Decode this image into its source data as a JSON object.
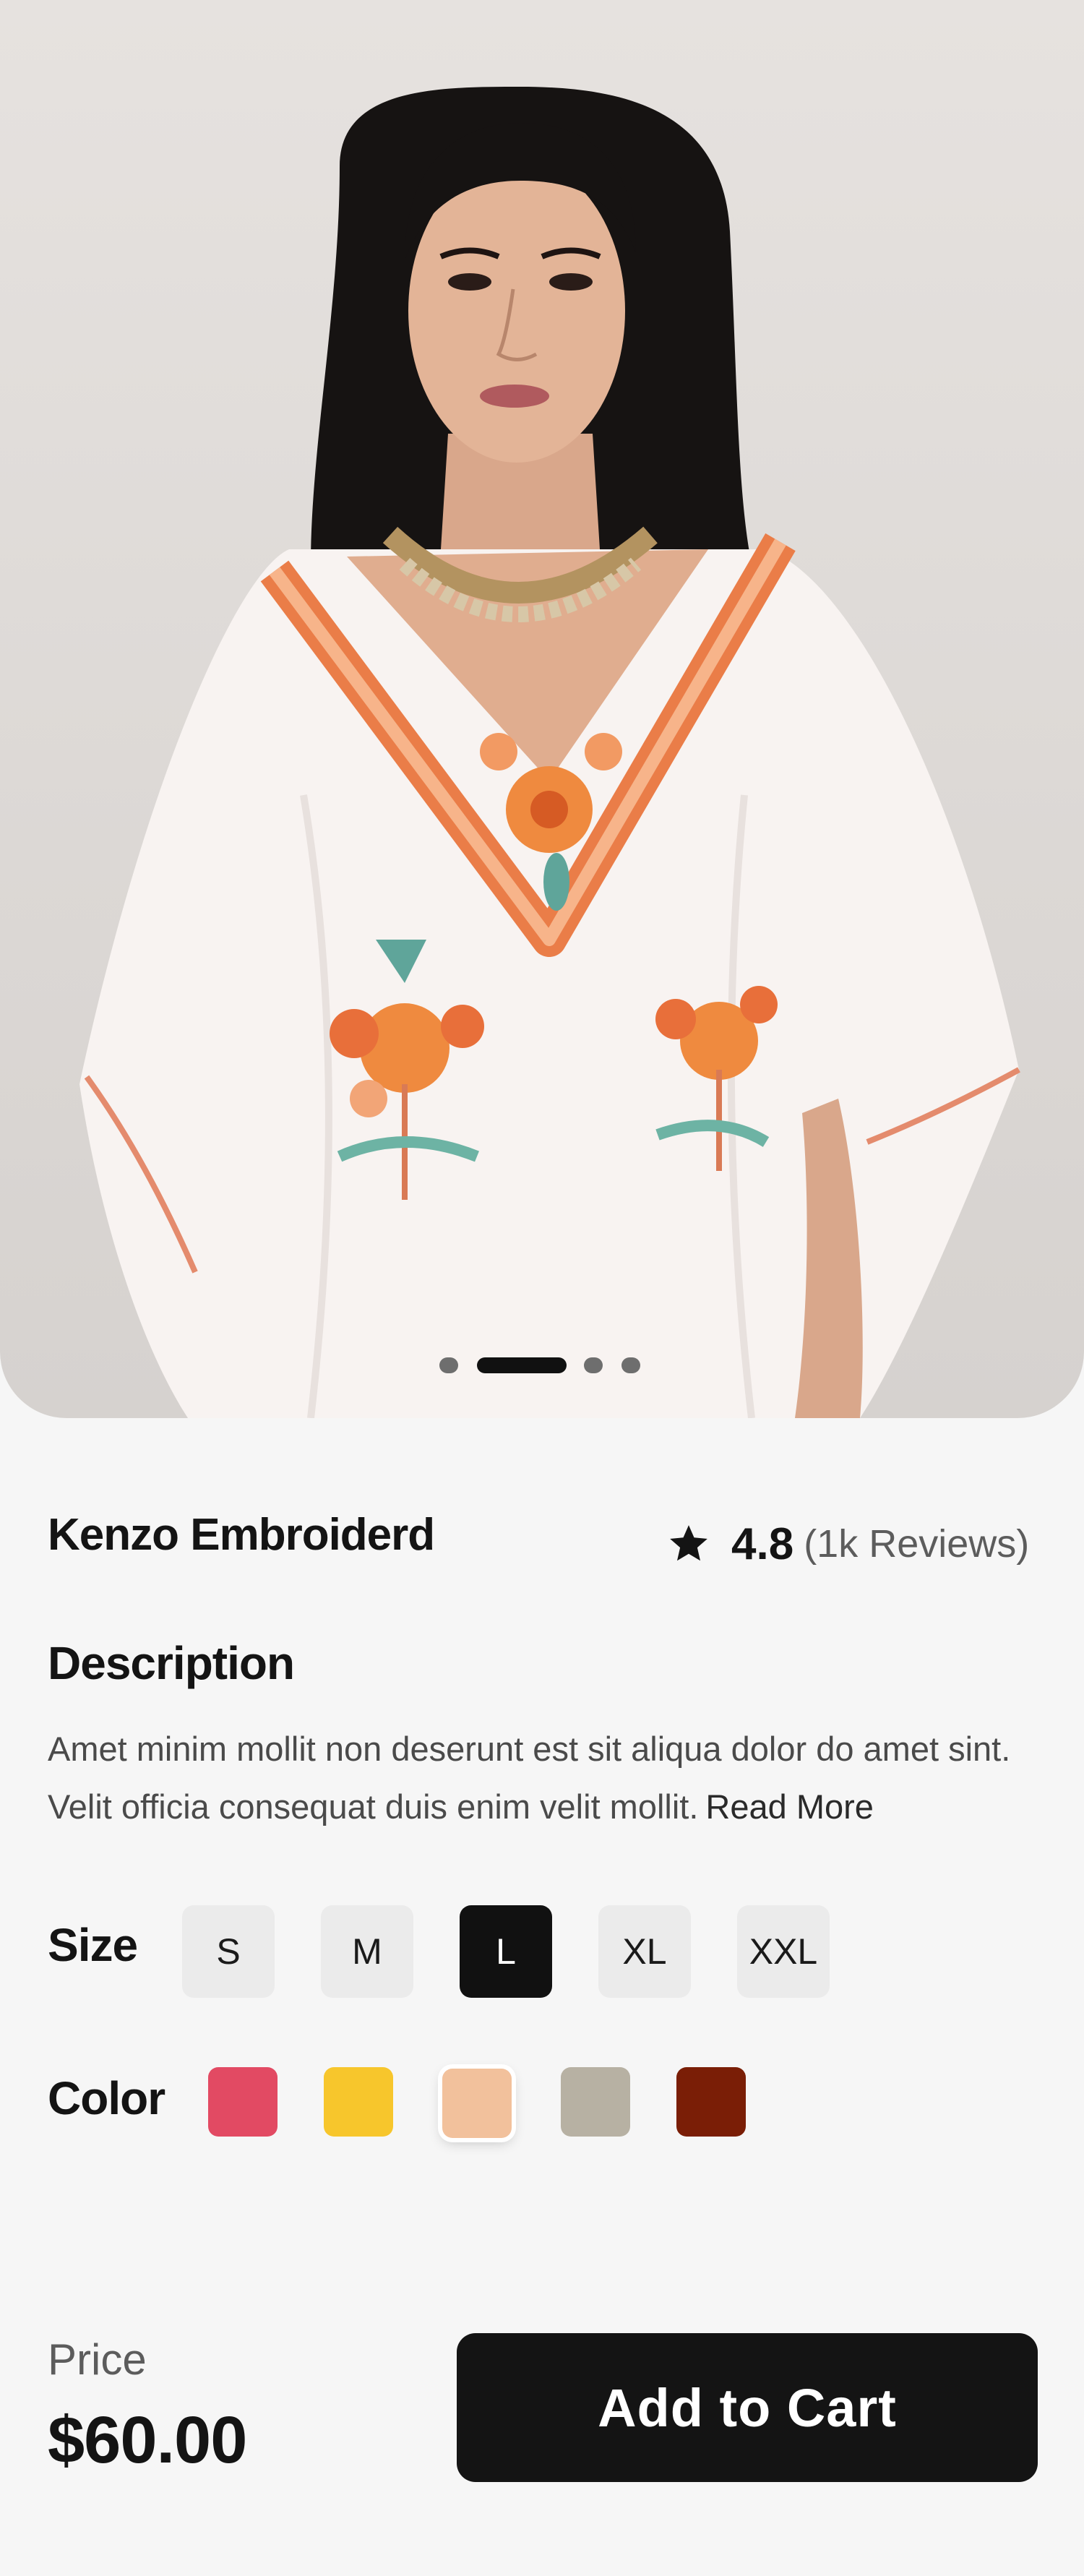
{
  "product": {
    "name": "Kenzo Embroiderd",
    "rating": "4.8",
    "reviews": "(1k Reviews)",
    "image_description": "star-icon"
  },
  "carousel": {
    "count": 4,
    "active_index": 1
  },
  "description": {
    "heading": "Description",
    "text": "Amet minim mollit non deserunt est sit aliqua dolor do amet sint. Velit officia consequat duis enim velit mollit.",
    "read_more": "Read More"
  },
  "size": {
    "label": "Size",
    "options": [
      "S",
      "M",
      "L",
      "XL",
      "XXL"
    ],
    "selected": "L"
  },
  "color": {
    "label": "Color",
    "options": [
      "#e24a63",
      "#f7c62c",
      "#f2c19c",
      "#b7b1a3",
      "#7a1e06"
    ],
    "selected": "#f2c19c"
  },
  "footer": {
    "price_label": "Price",
    "price": "$60.00",
    "cta": "Add to Cart"
  }
}
